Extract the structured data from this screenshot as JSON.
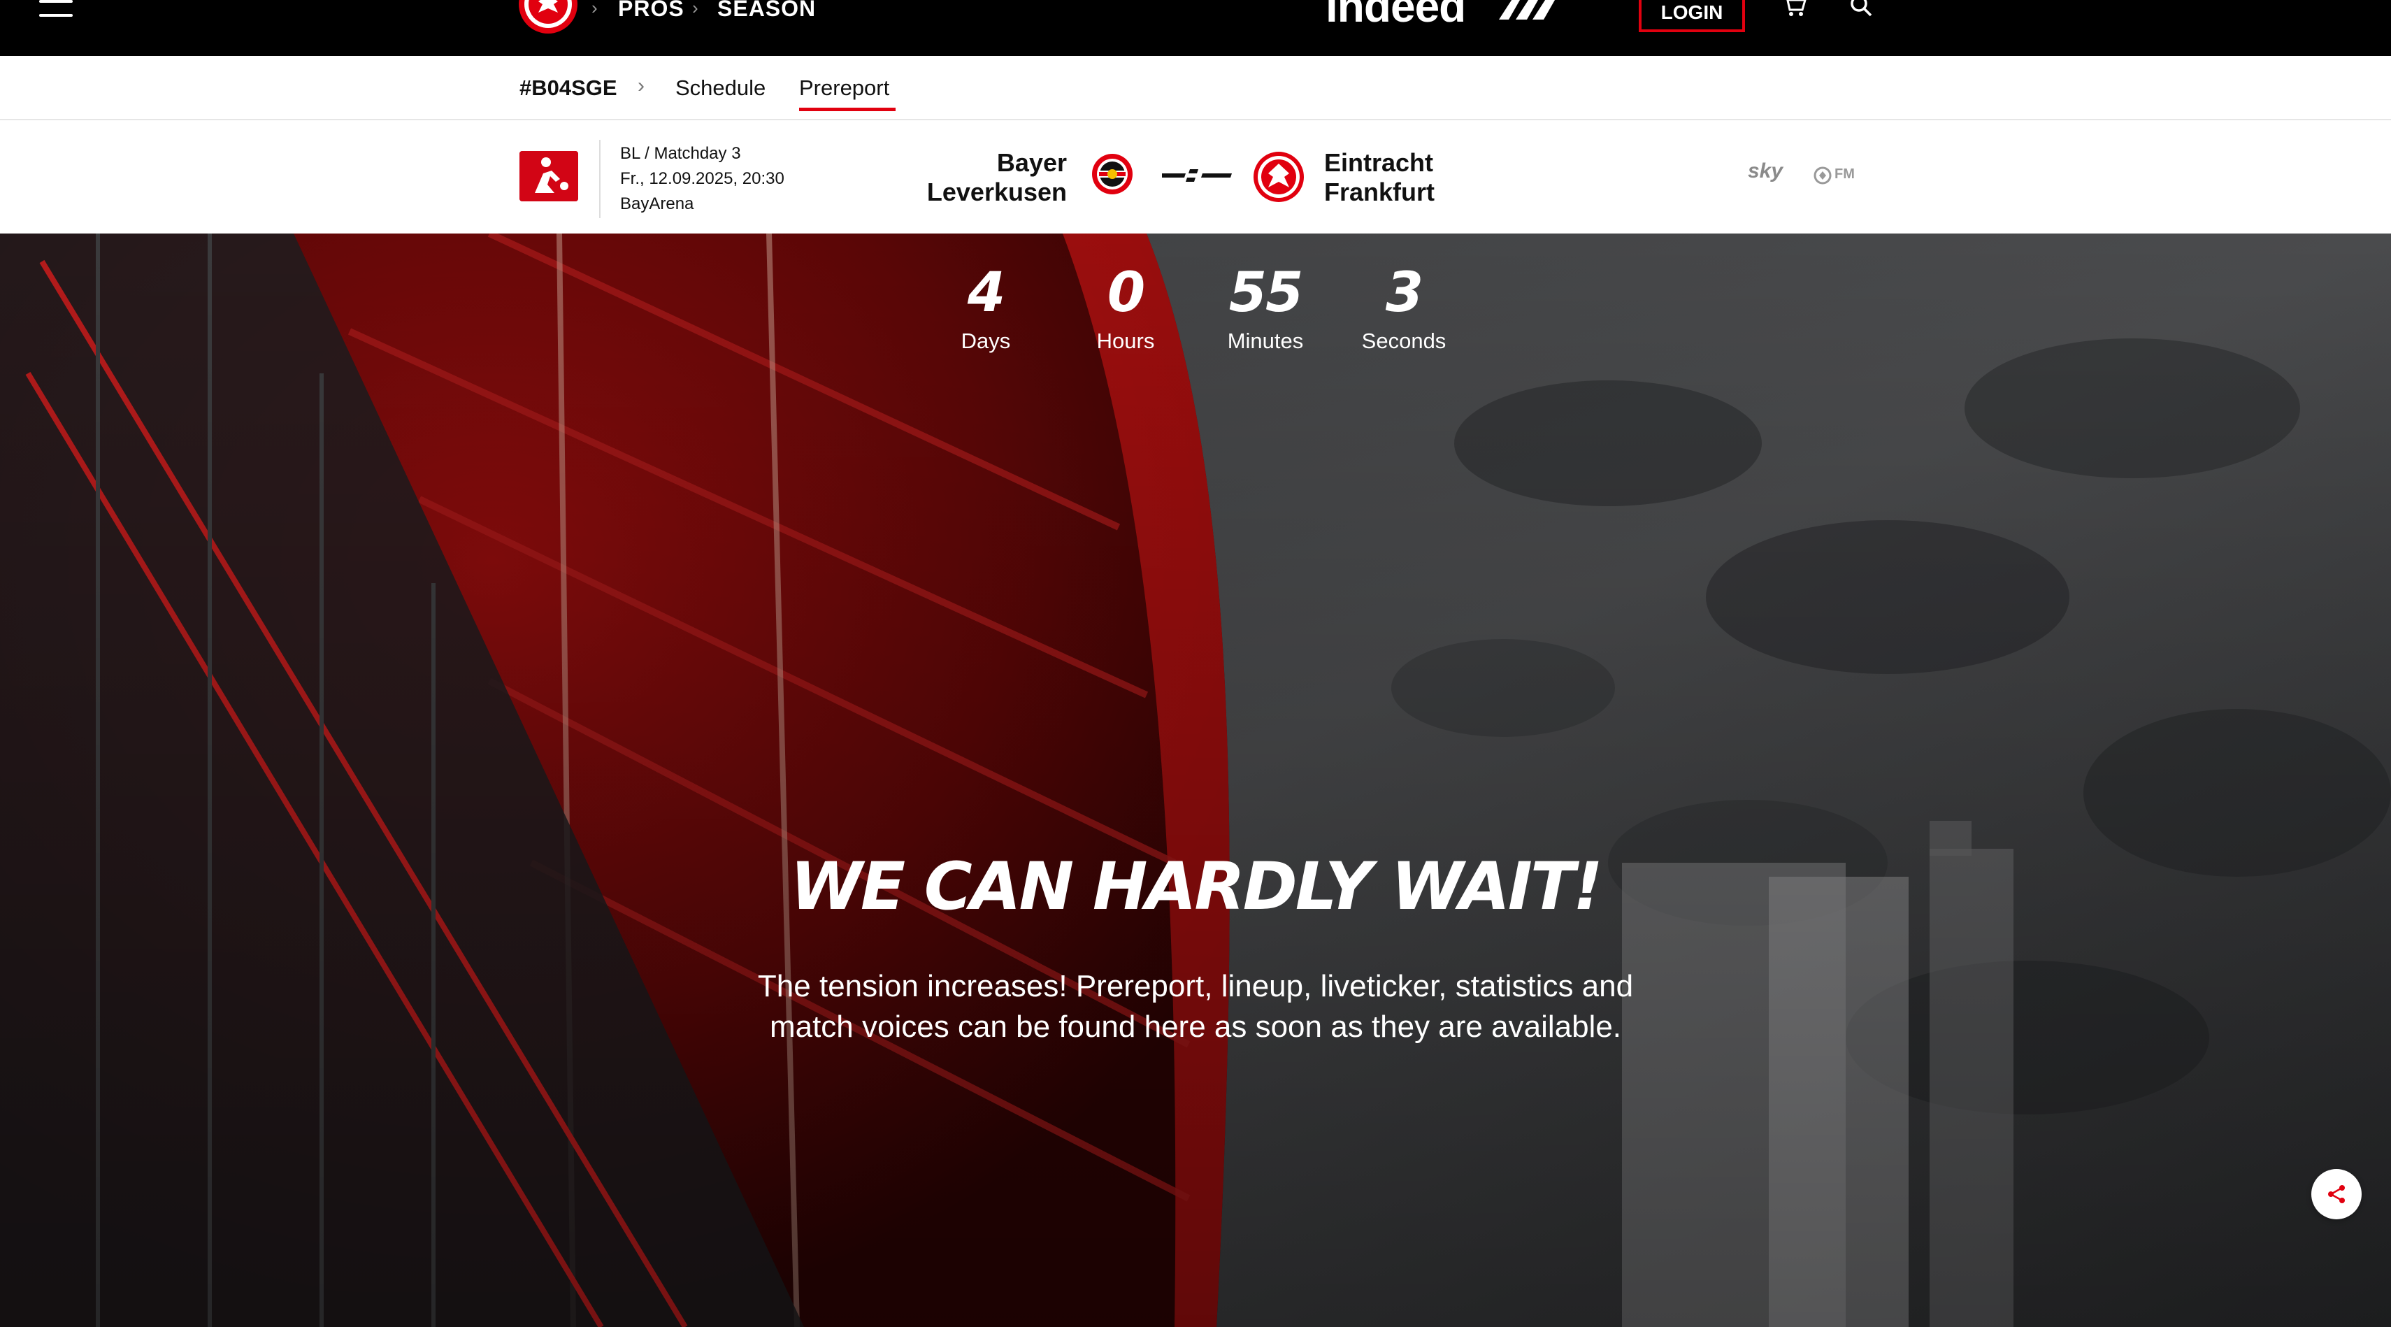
{
  "topbar": {
    "breadcrumb": [
      "PROS",
      "SEASON"
    ],
    "sponsor_text": "indeed",
    "login_label": "LOGIN",
    "icons": [
      "menu-icon",
      "eintracht-crest",
      "adidas-logo",
      "cart-icon",
      "search-icon"
    ]
  },
  "subnav": {
    "tag": "#B04SGE",
    "items": [
      {
        "label": "Schedule",
        "active": false
      },
      {
        "label": "Prereport",
        "active": true
      }
    ],
    "accent_color": "#e1000f"
  },
  "match": {
    "competition": "BL / Matchday 3",
    "datetime": "Fr., 12.09.2025, 20:30",
    "venue": "BayArena",
    "home_team": [
      "Bayer",
      "Leverkusen"
    ],
    "away_team": [
      "Eintracht",
      "Frankfurt"
    ],
    "broadcasters": [
      "sky",
      "FM"
    ]
  },
  "countdown": [
    {
      "value": "4",
      "label": "Days"
    },
    {
      "value": "0",
      "label": "Hours"
    },
    {
      "value": "55",
      "label": "Minutes"
    },
    {
      "value": "3",
      "label": "Seconds"
    }
  ],
  "hero": {
    "title": "WE CAN HARDLY WAIT!",
    "text_line1": "The tension increases! Prereport, lineup, liveticker, statistics and",
    "text_line2": "match voices can be found here as soon as they are available."
  },
  "colors": {
    "brand_red": "#e1000f",
    "topbar_bg": "#000000",
    "text_dark": "#111111"
  }
}
